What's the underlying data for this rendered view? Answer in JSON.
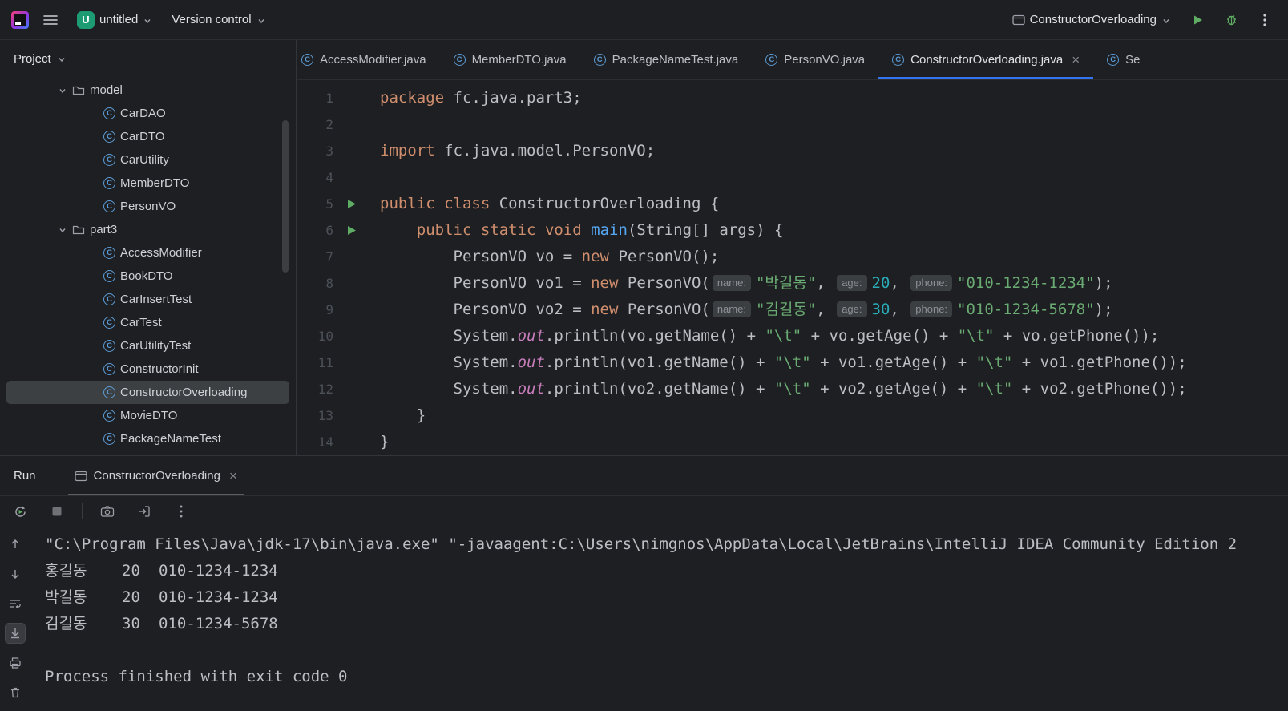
{
  "colors": {
    "accent": "#3574f0",
    "run_green": "#5fad65",
    "keyword": "#cf8e6d",
    "string": "#6aab73",
    "number": "#2aacb8",
    "method": "#56a8f5",
    "field": "#c77dbb",
    "badge": "#1d9b73"
  },
  "titlebar": {
    "project_badge": "U",
    "project_name": "untitled",
    "vcs": "Version control",
    "run_config": "ConstructorOverloading"
  },
  "project": {
    "header": "Project",
    "tree": [
      {
        "label": "model",
        "kind": "folder",
        "depth": 0,
        "expanded": true
      },
      {
        "label": "CarDAO",
        "kind": "class",
        "depth": 1
      },
      {
        "label": "CarDTO",
        "kind": "class",
        "depth": 1
      },
      {
        "label": "CarUtility",
        "kind": "class",
        "depth": 1
      },
      {
        "label": "MemberDTO",
        "kind": "class",
        "depth": 1
      },
      {
        "label": "PersonVO",
        "kind": "class",
        "depth": 1
      },
      {
        "label": "part3",
        "kind": "folder",
        "depth": 0,
        "expanded": true
      },
      {
        "label": "AccessModifier",
        "kind": "class",
        "depth": 1
      },
      {
        "label": "BookDTO",
        "kind": "class",
        "depth": 1
      },
      {
        "label": "CarInsertTest",
        "kind": "class",
        "depth": 1
      },
      {
        "label": "CarTest",
        "kind": "class",
        "depth": 1
      },
      {
        "label": "CarUtilityTest",
        "kind": "class",
        "depth": 1
      },
      {
        "label": "ConstructorInit",
        "kind": "class",
        "depth": 1
      },
      {
        "label": "ConstructorOverloading",
        "kind": "class",
        "depth": 1,
        "selected": true
      },
      {
        "label": "MovieDTO",
        "kind": "class",
        "depth": 1
      },
      {
        "label": "PackageNameTest",
        "kind": "class",
        "depth": 1
      }
    ]
  },
  "tabs": [
    {
      "label": "AccessModifier.java",
      "clip_left": true
    },
    {
      "label": "MemberDTO.java"
    },
    {
      "label": "PackageNameTest.java"
    },
    {
      "label": "PersonVO.java"
    },
    {
      "label": "ConstructorOverloading.java",
      "active": true,
      "closable": true
    },
    {
      "label": "Se"
    }
  ],
  "editor": {
    "lines": [
      {
        "num": 1,
        "tokens": [
          [
            "kw",
            "package"
          ],
          [
            "pl",
            " fc.java.part3;"
          ]
        ]
      },
      {
        "num": 2,
        "tokens": []
      },
      {
        "num": 3,
        "tokens": [
          [
            "kw",
            "import"
          ],
          [
            "pl",
            " fc.java.model.PersonVO;"
          ]
        ]
      },
      {
        "num": 4,
        "tokens": []
      },
      {
        "num": 5,
        "run": true,
        "tokens": [
          [
            "kw",
            "public"
          ],
          [
            "pl",
            " "
          ],
          [
            "kw",
            "class"
          ],
          [
            "pl",
            " ConstructorOverloading {"
          ]
        ]
      },
      {
        "num": 6,
        "run": true,
        "tokens": [
          [
            "pl",
            "    "
          ],
          [
            "kw",
            "public"
          ],
          [
            "pl",
            " "
          ],
          [
            "kw",
            "static"
          ],
          [
            "pl",
            " "
          ],
          [
            "kw",
            "void"
          ],
          [
            "pl",
            " "
          ],
          [
            "fn",
            "main"
          ],
          [
            "pl",
            "(String[] args) {"
          ]
        ]
      },
      {
        "num": 7,
        "tokens": [
          [
            "pl",
            "        PersonVO vo = "
          ],
          [
            "kw",
            "new"
          ],
          [
            "pl",
            " PersonVO();"
          ]
        ]
      },
      {
        "num": 8,
        "tokens": [
          [
            "pl",
            "        PersonVO vo1 = "
          ],
          [
            "kw",
            "new"
          ],
          [
            "pl",
            " PersonVO("
          ],
          [
            "hint",
            "name:"
          ],
          [
            "str",
            "\"박길동\""
          ],
          [
            "pl",
            ", "
          ],
          [
            "hint",
            "age:"
          ],
          [
            "num",
            "20"
          ],
          [
            "pl",
            ", "
          ],
          [
            "hint",
            "phone:"
          ],
          [
            "str",
            "\"010-1234-1234\""
          ],
          [
            "pl",
            ");"
          ]
        ]
      },
      {
        "num": 9,
        "tokens": [
          [
            "pl",
            "        PersonVO vo2 = "
          ],
          [
            "kw",
            "new"
          ],
          [
            "pl",
            " PersonVO("
          ],
          [
            "hint",
            "name:"
          ],
          [
            "str",
            "\"김길동\""
          ],
          [
            "pl",
            ", "
          ],
          [
            "hint",
            "age:"
          ],
          [
            "num",
            "30"
          ],
          [
            "pl",
            ", "
          ],
          [
            "hint",
            "phone:"
          ],
          [
            "str",
            "\"010-1234-5678\""
          ],
          [
            "pl",
            ");"
          ]
        ]
      },
      {
        "num": 10,
        "tokens": [
          [
            "pl",
            "        System."
          ],
          [
            "fld",
            "out"
          ],
          [
            "pl",
            ".println(vo.getName() + "
          ],
          [
            "str",
            "\"\\t\""
          ],
          [
            "pl",
            " + vo.getAge() + "
          ],
          [
            "str",
            "\"\\t\""
          ],
          [
            "pl",
            " + vo.getPhone());"
          ]
        ]
      },
      {
        "num": 11,
        "tokens": [
          [
            "pl",
            "        System."
          ],
          [
            "fld",
            "out"
          ],
          [
            "pl",
            ".println(vo1.getName() + "
          ],
          [
            "str",
            "\"\\t\""
          ],
          [
            "pl",
            " + vo1.getAge() + "
          ],
          [
            "str",
            "\"\\t\""
          ],
          [
            "pl",
            " + vo1.getPhone());"
          ]
        ]
      },
      {
        "num": 12,
        "tokens": [
          [
            "pl",
            "        System."
          ],
          [
            "fld",
            "out"
          ],
          [
            "pl",
            ".println(vo2.getName() + "
          ],
          [
            "str",
            "\"\\t\""
          ],
          [
            "pl",
            " + vo2.getAge() + "
          ],
          [
            "str",
            "\"\\t\""
          ],
          [
            "pl",
            " + vo2.getPhone());"
          ]
        ]
      },
      {
        "num": 13,
        "tokens": [
          [
            "pl",
            "    }"
          ]
        ]
      },
      {
        "num": 14,
        "tokens": [
          [
            "pl",
            "}"
          ]
        ]
      }
    ]
  },
  "run": {
    "title": "Run",
    "tab": "ConstructorOverloading",
    "jvm_line": "\"C:\\Program Files\\Java\\jdk-17\\bin\\java.exe\" \"-javaagent:C:\\Users\\nimgnos\\AppData\\Local\\JetBrains\\IntelliJ IDEA Community Edition 2",
    "rows": [
      [
        "홍길동",
        "20",
        "010-1234-1234"
      ],
      [
        "박길동",
        "20",
        "010-1234-1234"
      ],
      [
        "김길동",
        "30",
        "010-1234-5678"
      ]
    ],
    "exit_line": "Process finished with exit code 0"
  }
}
